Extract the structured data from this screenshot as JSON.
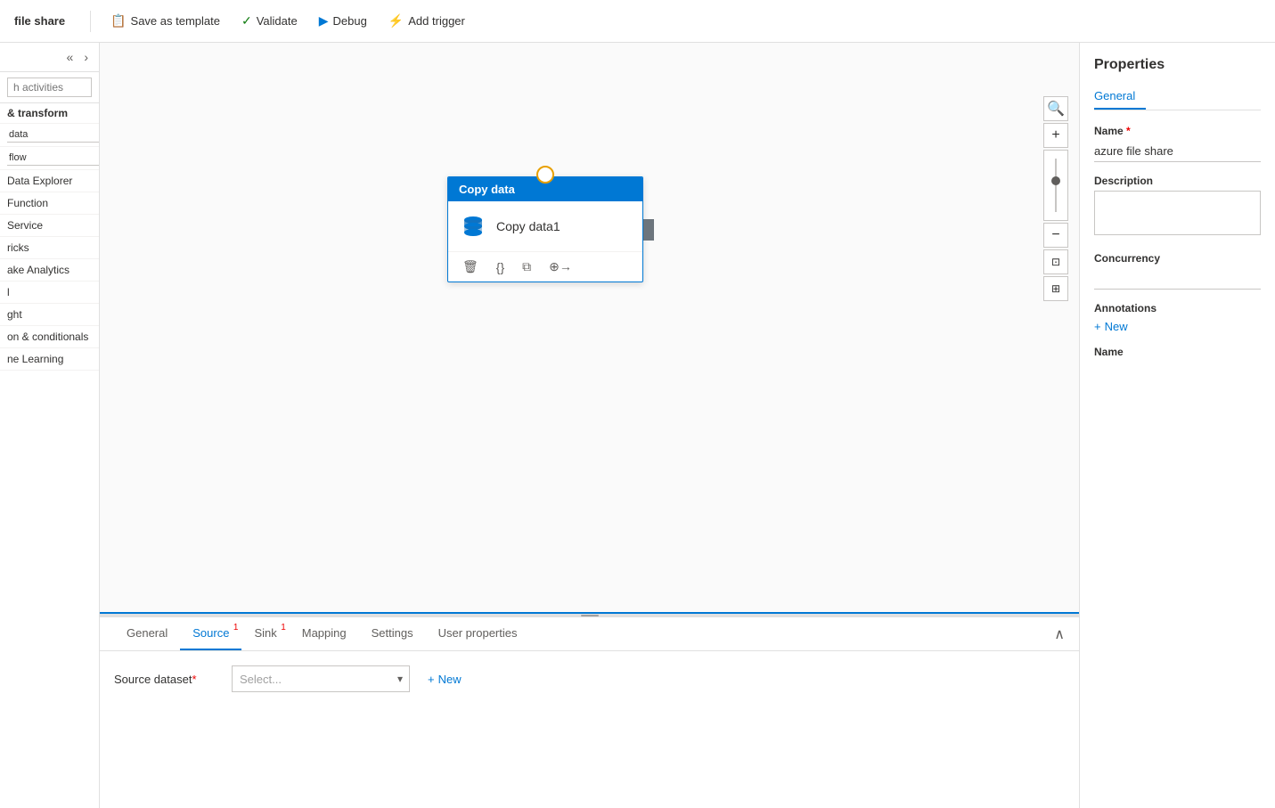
{
  "toolbar": {
    "title": "file share",
    "save_template_label": "Save as template",
    "validate_label": "Validate",
    "debug_label": "Debug",
    "add_trigger_label": "Add trigger"
  },
  "sidebar": {
    "search_placeholder": "h activities",
    "section_move_transform": "& transform",
    "input_data_value": "data",
    "input_flow_value": "flow",
    "items": [
      {
        "label": "Data Explorer"
      },
      {
        "label": "Function"
      },
      {
        "label": "Service"
      },
      {
        "label": "ricks"
      },
      {
        "label": "ake Analytics"
      },
      {
        "label": "l"
      },
      {
        "label": "ght"
      },
      {
        "label": "on & conditionals"
      },
      {
        "label": "ne Learning"
      }
    ]
  },
  "canvas": {
    "activity": {
      "header": "Copy data",
      "name": "Copy data1"
    }
  },
  "bottom_panel": {
    "tabs": [
      {
        "label": "General",
        "badge": null
      },
      {
        "label": "Source",
        "badge": "1"
      },
      {
        "label": "Sink",
        "badge": "1"
      },
      {
        "label": "Mapping",
        "badge": null
      },
      {
        "label": "Settings",
        "badge": null
      },
      {
        "label": "User properties",
        "badge": null
      }
    ],
    "active_tab": "Source",
    "source_dataset_label": "Source dataset",
    "source_dataset_required": "*",
    "source_dataset_placeholder": "Select...",
    "new_button_label": "New"
  },
  "properties": {
    "title": "Properties",
    "tabs": [
      {
        "label": "General"
      }
    ],
    "name_label": "Name",
    "name_required": "*",
    "name_value": "azure file share",
    "description_label": "Description",
    "description_value": "",
    "concurrency_label": "Concurrency",
    "concurrency_value": "",
    "annotations_label": "Annotations",
    "add_annotation_label": "New",
    "name_field_label": "Name"
  },
  "icons": {
    "collapse_left": "«",
    "collapse_right": "»",
    "scroll_down": "▼",
    "chevron_down": "▾",
    "plus": "+",
    "search": "🔍",
    "validate_check": "✓",
    "debug_play": "▶",
    "trigger_bolt": "⚡",
    "delete": "🗑",
    "code": "{}",
    "copy": "⧉",
    "arrow_right": "→",
    "zoom_in": "+",
    "zoom_out": "−",
    "fit": "⊡",
    "layout": "⊞",
    "collapse_up": "∧",
    "template_save": "📋"
  }
}
